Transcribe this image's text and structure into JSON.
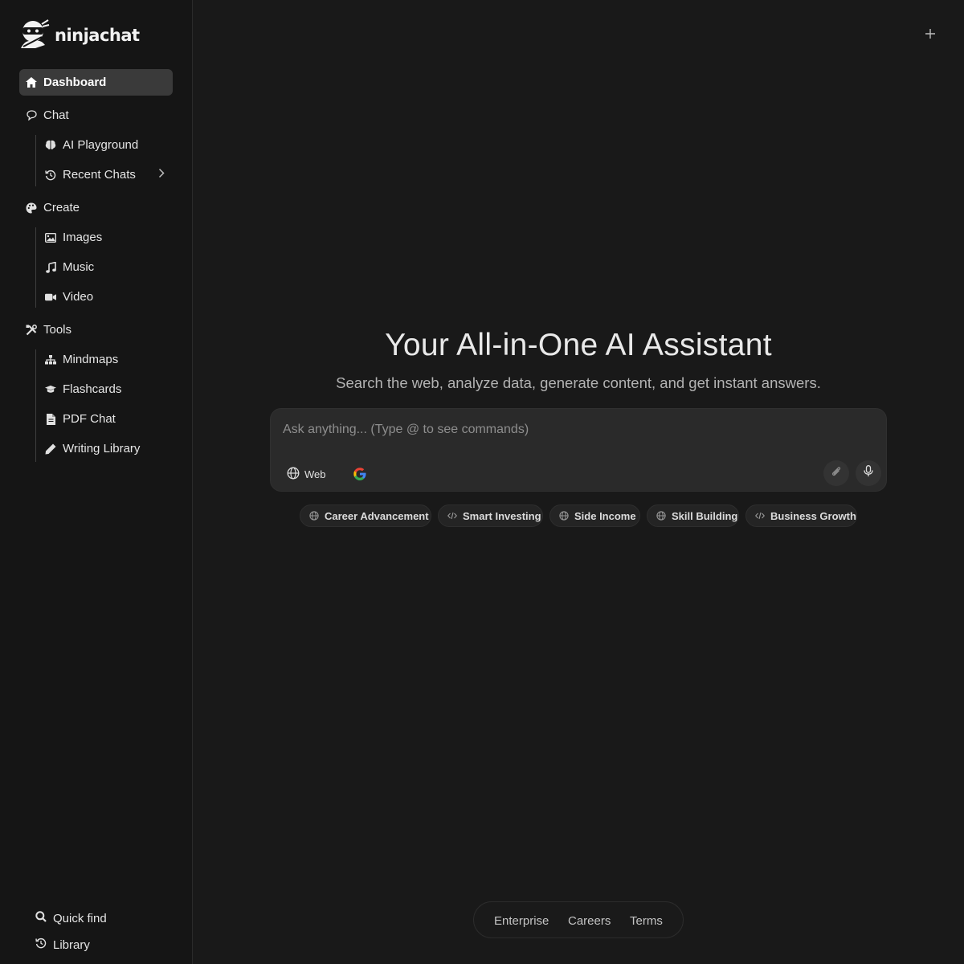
{
  "brand": {
    "name": "ninjachat"
  },
  "sidebar": {
    "dashboard": {
      "label": "Dashboard",
      "icon": "home-icon"
    },
    "chat": {
      "label": "Chat",
      "icon": "chat-bubble-icon",
      "items": [
        {
          "label": "AI Playground",
          "icon": "brain-icon"
        },
        {
          "label": "Recent Chats",
          "icon": "history-icon"
        }
      ]
    },
    "create": {
      "label": "Create",
      "icon": "palette-icon",
      "items": [
        {
          "label": "Images",
          "icon": "image-icon"
        },
        {
          "label": "Music",
          "icon": "music-note-icon"
        },
        {
          "label": "Video",
          "icon": "video-camera-icon"
        }
      ]
    },
    "tools": {
      "label": "Tools",
      "icon": "tools-icon",
      "items": [
        {
          "label": "Mindmaps",
          "icon": "sitemap-icon"
        },
        {
          "label": "Flashcards",
          "icon": "graduation-cap-icon"
        },
        {
          "label": "PDF Chat",
          "icon": "file-icon"
        },
        {
          "label": "Writing Library",
          "icon": "pencil-icon"
        }
      ]
    },
    "bottom": [
      {
        "label": "Quick find",
        "icon": "search-icon"
      },
      {
        "label": "Library",
        "icon": "history-icon"
      }
    ]
  },
  "main": {
    "title": "Your All-in-One AI Assistant",
    "subtitle": "Search the web, analyze data, generate content, and get instant answers.",
    "composer": {
      "placeholder": "Ask anything... (Type @ to see commands)",
      "web_label": "Web"
    },
    "chips": [
      {
        "label": "Career Advancement",
        "icon": "globe-icon"
      },
      {
        "label": "Smart Investing",
        "icon": "code-icon"
      },
      {
        "label": "Side Income",
        "icon": "globe-icon"
      },
      {
        "label": "Skill Building",
        "icon": "globe-icon"
      },
      {
        "label": "Business Growth",
        "icon": "code-icon"
      }
    ],
    "footer": [
      "Enterprise",
      "Careers",
      "Terms"
    ]
  },
  "colors": {
    "background": "#191919",
    "sidebar": "#151515",
    "active_item": "#3a3a3a",
    "composer": "#2a2a2a"
  }
}
